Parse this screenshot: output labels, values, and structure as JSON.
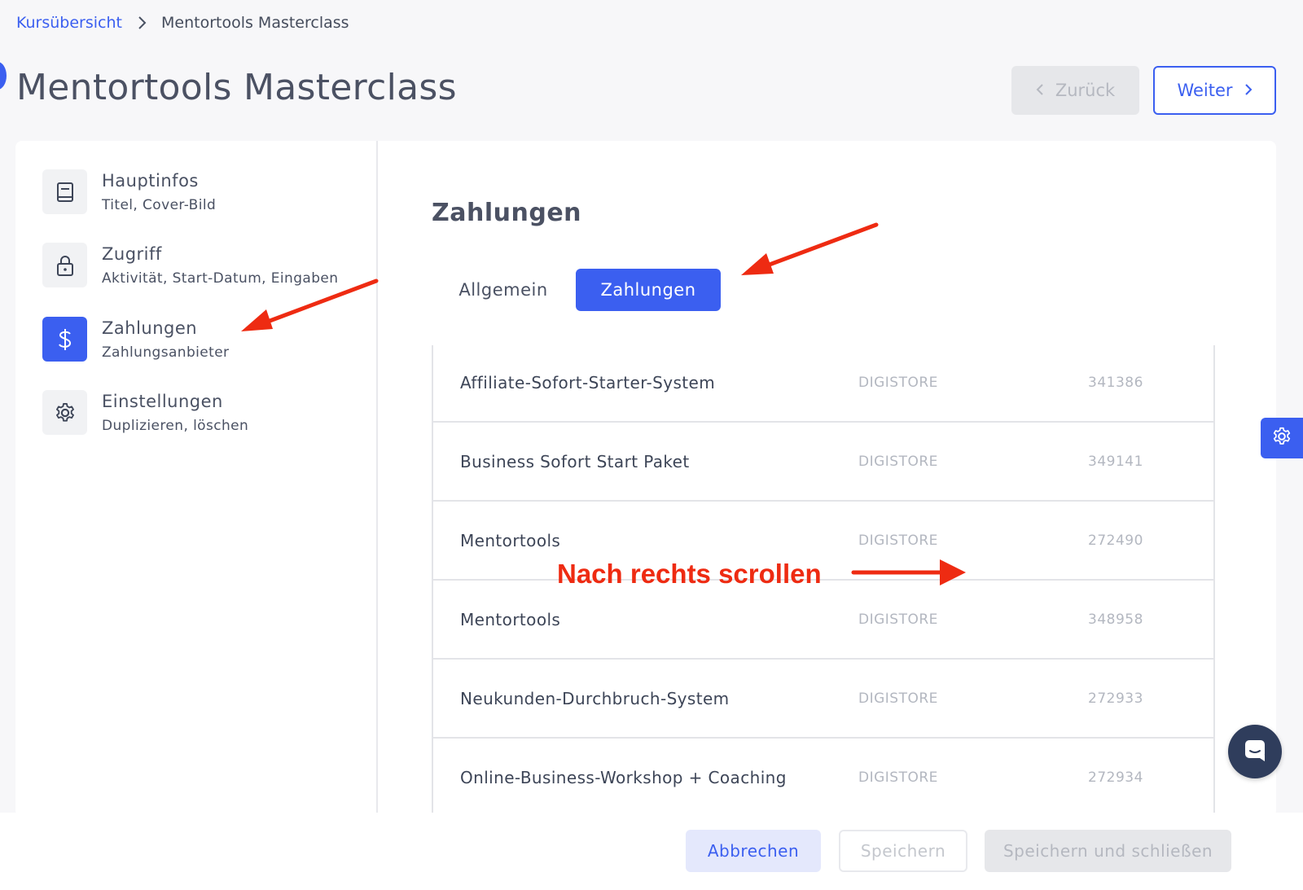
{
  "breadcrumb": {
    "root": "Kursübersicht",
    "current": "Mentortools Masterclass"
  },
  "page_title": "Mentortools Masterclass",
  "nav_buttons": {
    "back": "Zurück",
    "next": "Weiter"
  },
  "sidebar": {
    "items": [
      {
        "title": "Hauptinfos",
        "subtitle": "Titel, Cover-Bild",
        "icon": "book-icon",
        "active": false
      },
      {
        "title": "Zugriff",
        "subtitle": "Aktivität, Start-Datum, Eingaben",
        "icon": "lock-icon",
        "active": false
      },
      {
        "title": "Zahlungen",
        "subtitle": "Zahlungsanbieter",
        "icon": "dollar-icon",
        "active": true
      },
      {
        "title": "Einstellungen",
        "subtitle": "Duplizieren, löschen",
        "icon": "gear-icon",
        "active": false
      }
    ]
  },
  "section_title": "Zahlungen",
  "tabs": [
    {
      "label": "Allgemein",
      "active": false
    },
    {
      "label": "Zahlungen",
      "active": true
    }
  ],
  "products": [
    {
      "name": "Affiliate-Sofort-Starter-System",
      "provider": "DIGISTORE",
      "id": "341386"
    },
    {
      "name": "Business Sofort Start Paket",
      "provider": "DIGISTORE",
      "id": "349141"
    },
    {
      "name": "Mentortools",
      "provider": "DIGISTORE",
      "id": "272490"
    },
    {
      "name": "Mentortools",
      "provider": "DIGISTORE",
      "id": "348958"
    },
    {
      "name": "Neukunden-Durchbruch-System",
      "provider": "DIGISTORE",
      "id": "272933"
    },
    {
      "name": "Online-Business-Workshop + Coaching",
      "provider": "DIGISTORE",
      "id": "272934"
    }
  ],
  "footer": {
    "cancel": "Abbrechen",
    "save": "Speichern",
    "save_close": "Speichern und schließen"
  },
  "annotation": {
    "text": "Nach rechts scrollen"
  },
  "colors": {
    "accent": "#3b5ff0",
    "annotation": "#ee2b12",
    "chat": "#2f3d5c"
  }
}
